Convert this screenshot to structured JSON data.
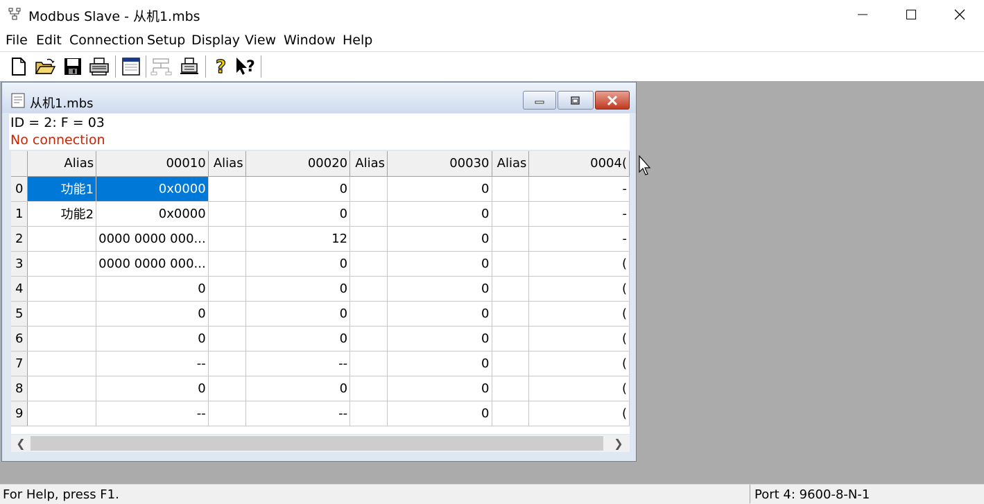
{
  "window": {
    "title": "Modbus Slave - 从机1.mbs",
    "controls": [
      "minimize",
      "maximize",
      "close"
    ]
  },
  "menu": [
    "File",
    "Edit",
    "Connection",
    "Setup",
    "Display",
    "View",
    "Window",
    "Help"
  ],
  "toolbar": {
    "buttons": [
      "new-icon",
      "open-icon",
      "save-icon",
      "print-icon",
      "window-icon",
      "connection-icon",
      "device-icon",
      "help-icon",
      "context-help-icon"
    ]
  },
  "child": {
    "title": "从机1.mbs",
    "id_line": "ID = 2: F = 03",
    "connection_status": "No connection",
    "connection_color": "#cc2200"
  },
  "grid": {
    "columns": [
      "Alias",
      "00010",
      "Alias",
      "00020",
      "Alias",
      "00030",
      "Alias",
      "0004("
    ],
    "rows": [
      {
        "idx": "0",
        "cells": [
          "功能1",
          "0x0000",
          "",
          "0",
          "",
          "0",
          "",
          "-"
        ]
      },
      {
        "idx": "1",
        "cells": [
          "功能2",
          "0x0000",
          "",
          "0",
          "",
          "0",
          "",
          "-"
        ]
      },
      {
        "idx": "2",
        "cells": [
          "",
          "0000 0000 000...",
          "",
          "12",
          "",
          "0",
          "",
          "-"
        ]
      },
      {
        "idx": "3",
        "cells": [
          "",
          "0000 0000 000...",
          "",
          "0",
          "",
          "0",
          "",
          "("
        ]
      },
      {
        "idx": "4",
        "cells": [
          "",
          "0",
          "",
          "0",
          "",
          "0",
          "",
          "("
        ]
      },
      {
        "idx": "5",
        "cells": [
          "",
          "0",
          "",
          "0",
          "",
          "0",
          "",
          "("
        ]
      },
      {
        "idx": "6",
        "cells": [
          "",
          "0",
          "",
          "0",
          "",
          "0",
          "",
          "("
        ]
      },
      {
        "idx": "7",
        "cells": [
          "",
          "--",
          "",
          "--",
          "",
          "0",
          "",
          "("
        ]
      },
      {
        "idx": "8",
        "cells": [
          "",
          "0",
          "",
          "0",
          "",
          "0",
          "",
          "("
        ]
      },
      {
        "idx": "9",
        "cells": [
          "",
          "--",
          "",
          "--",
          "",
          "0",
          "",
          "("
        ]
      }
    ],
    "selection_color": "#0078d7"
  },
  "status": {
    "left": "For Help, press F1.",
    "right": "Port 4: 9600-8-N-1"
  }
}
